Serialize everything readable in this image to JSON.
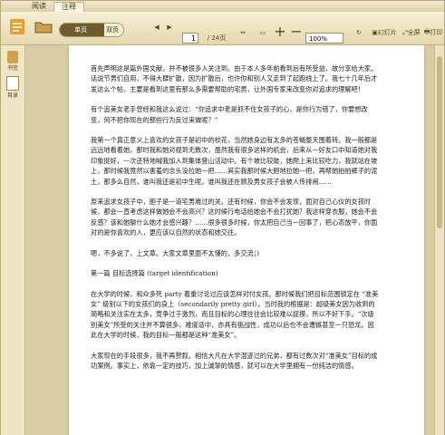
{
  "tabs": [
    {
      "label": "阅读"
    },
    {
      "label": "注释"
    }
  ],
  "toolbar": {
    "view_single": "单页",
    "view_double": "双页",
    "page_current": "1",
    "page_total": "/ 24页",
    "zoom": "100%",
    "slideshow": "幻灯片",
    "fullscreen": "全屏",
    "print": "打印"
  },
  "sidebar": {
    "items": [
      {
        "label": "书签"
      },
      {
        "label": "目录"
      }
    ]
  },
  "document": {
    "paragraphs": [
      "首先声明这是篇外国文献，并不被很多人关注到。由于本人多年前看到后有所受益，故分享给大家。话说节男们自用，不得大肆扩散，因为扩散后，也许你和别人又走到了起跑线上了。我七十几年后才发这么个帖，主要是看到这里有那么多需要帮助的宅男，让外国专家来改变你对追求的理解吧！",
      "有个追美女老手曾经和我这么说过：“你追求中老是抓不住女孩子的心，是你行为错了，你要想改变，何不把你现在的那些行为反过来做呢？”",
      "我第一个真正意义上喜欢的女孩子是初中的校花，当然她身边有太多的苍蝇整天围着转。我一般都是远远地看着她，那时我和她对视到无数次，虽然我有很多这样的机会，后来从一好友口中知道她对我印象挺好，一次还特地喊我加入到集体登山活动中。有个坡比较陡，她爬上来比较吃力，我就站在坡上，那时候我竟然以害羞的念头没拉她一把……其实我那时候大胆地拉她一把，再帮她拍拍裤子的泥土，那多么自然，谁叫我还是初中生呢，谁叫我还在顾及男女孩子会被人传排闹……",
      "原来追求女孩子中，胆子是一道宅男难过的关。还有时候，你会不会发现，面对自己心仪的女孩时候，都会一直考虑这样做她会不会高兴？这时候行电话给她会不会打扰她？我这样穿衣服，她会不会反感？该和她聊什么她才会感兴趣？……很多很多时候，你太把自己当一回事了，把心态放平，你面对的是你喜欢的人，更应该以自然的状态和她交往。",
      "嗯，不多说了，上文章。大家文章里面不太懂的，多交流；)",
      "第一篇 目标选择篇 (target identification)",
      "在大学的时候，和众多死 party 着重讨论过应该怎样对付女孩。那时候我们把目标范围锁定在 “准美女” 级别以下的女孩们的身上（secondarily pretty girl）。当时我的根据是：超级美女因为收到的简略和关注实在太多，竞争过于激烈，而且目标的心理往往会比较难以捉摸，所以不好下手。“次级别美女”所受的关注并不算很多，难度适中，亦具有挑战性，成功以后也不会遭嫉甚至一只恐龙。因此在大学的时候，我的目标一般都是这种“准美女”。",
      "大家现在的手段很多，我不再赘叙。相信大凡在大学混迹过的兄弟，都有过数次对“准美女”目标的成功案例。事实上，依靠一定的技巧，加上诚挚的情感，就可以在大学里拥有一份纯洁的情感。"
    ]
  }
}
